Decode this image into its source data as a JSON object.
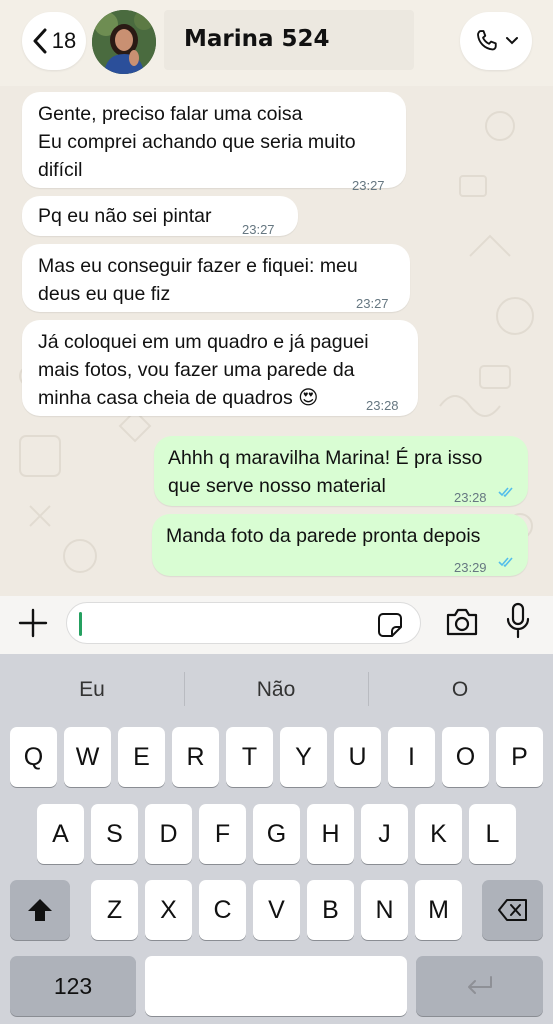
{
  "header": {
    "back_count": "18",
    "contact_name": "Marina 524"
  },
  "messages": [
    {
      "text_lines": [
        "Gente, preciso falar uma coisa",
        "Eu comprei achando que seria muito",
        "difícil"
      ],
      "time": "23:27",
      "direction": "incoming"
    },
    {
      "text_lines": [
        "Pq eu não sei pintar"
      ],
      "time": "23:27",
      "direction": "incoming"
    },
    {
      "text_lines": [
        "Mas eu conseguir fazer e fiquei: meu",
        "deus eu que fiz"
      ],
      "time": "23:27",
      "direction": "incoming"
    },
    {
      "text_lines": [
        "Já coloquei em um quadro e já paguei",
        "mais fotos, vou fazer uma parede da",
        "minha casa cheia de quadros 😍"
      ],
      "time": "23:28",
      "direction": "incoming"
    },
    {
      "text_lines": [
        "Ahhh q maravilha Marina! É pra isso",
        "que serve nosso material"
      ],
      "time": "23:28",
      "direction": "outgoing",
      "status": "read"
    },
    {
      "text_lines": [
        "Manda foto da parede pronta depois"
      ],
      "time": "23:29",
      "direction": "outgoing",
      "status": "read"
    }
  ],
  "input": {
    "value": ""
  },
  "keyboard": {
    "suggestions": [
      "Eu",
      "Não",
      "O"
    ],
    "row1": [
      "Q",
      "W",
      "E",
      "R",
      "T",
      "Y",
      "U",
      "I",
      "O",
      "P"
    ],
    "row2": [
      "A",
      "S",
      "D",
      "F",
      "G",
      "H",
      "J",
      "K",
      "L"
    ],
    "row3": [
      "Z",
      "X",
      "C",
      "V",
      "B",
      "N",
      "M"
    ],
    "numbers_key": "123"
  },
  "colors": {
    "chat_background": "#efeae2",
    "incoming_bubble": "#ffffff",
    "outgoing_bubble": "#d9fdd3",
    "read_ticks": "#53bdeb",
    "cursor": "#25a060"
  },
  "icons": [
    "chevron-left-icon",
    "phone-icon",
    "chevron-down-icon",
    "plus-icon",
    "sticker-icon",
    "camera-icon",
    "microphone-icon",
    "shift-icon",
    "backspace-icon",
    "return-icon"
  ]
}
